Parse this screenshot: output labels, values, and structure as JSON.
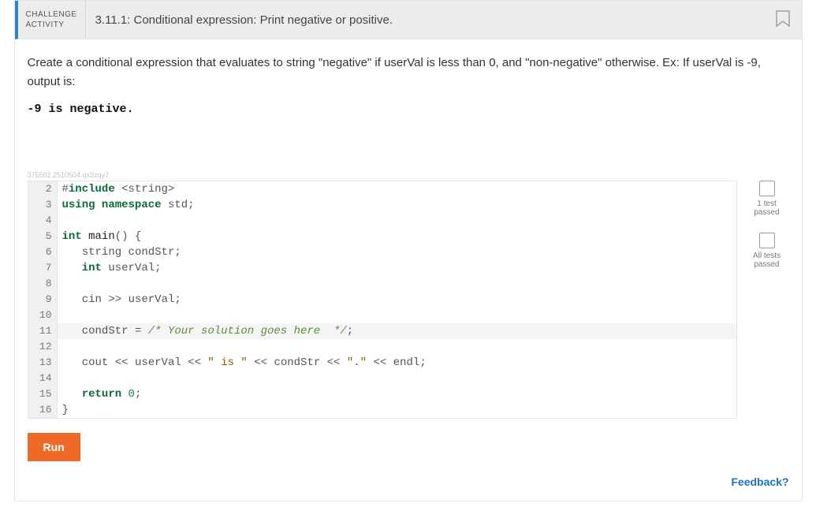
{
  "header": {
    "badge_line1": "CHALLENGE",
    "badge_line2": "ACTIVITY",
    "title": "3.11.1: Conditional expression: Print negative or positive."
  },
  "instructions": {
    "text": "Create a conditional expression that evaluates to string \"negative\" if userVal is less than 0, and \"non-negative\" otherwise. Ex: If userVal is -9, output is:",
    "example_output": "-9 is negative."
  },
  "watermark": "375502.2510504.qx3zqy7",
  "code": {
    "lines": [
      {
        "n": 2,
        "tokens": [
          [
            "pun",
            "#"
          ],
          [
            "kw",
            "include"
          ],
          [
            "pun",
            " "
          ],
          [
            "op",
            "<"
          ],
          [
            "ns",
            "string"
          ],
          [
            "op",
            ">"
          ]
        ]
      },
      {
        "n": 3,
        "tokens": [
          [
            "kw",
            "using"
          ],
          [
            "pun",
            " "
          ],
          [
            "kw",
            "namespace"
          ],
          [
            "pun",
            " "
          ],
          [
            "ns",
            "std"
          ],
          [
            "pun",
            ";"
          ]
        ]
      },
      {
        "n": 4,
        "tokens": []
      },
      {
        "n": 5,
        "tokens": [
          [
            "typ",
            "int"
          ],
          [
            "pun",
            " "
          ],
          [
            "fn",
            "main"
          ],
          [
            "pun",
            "()"
          ],
          [
            "pun",
            " "
          ],
          [
            "pun",
            "{"
          ]
        ]
      },
      {
        "n": 6,
        "tokens": [
          [
            "pun",
            "   "
          ],
          [
            "ns",
            "string"
          ],
          [
            "pun",
            " "
          ],
          [
            "ns",
            "condStr"
          ],
          [
            "pun",
            ";"
          ]
        ]
      },
      {
        "n": 7,
        "tokens": [
          [
            "pun",
            "   "
          ],
          [
            "typ",
            "int"
          ],
          [
            "pun",
            " "
          ],
          [
            "ns",
            "userVal"
          ],
          [
            "pun",
            ";"
          ]
        ]
      },
      {
        "n": 8,
        "tokens": []
      },
      {
        "n": 9,
        "tokens": [
          [
            "pun",
            "   "
          ],
          [
            "ns",
            "cin"
          ],
          [
            "pun",
            " "
          ],
          [
            "op",
            ">>"
          ],
          [
            "pun",
            " "
          ],
          [
            "ns",
            "userVal"
          ],
          [
            "pun",
            ";"
          ]
        ]
      },
      {
        "n": 10,
        "tokens": []
      },
      {
        "n": 11,
        "highlight": true,
        "tokens": [
          [
            "pun",
            "   "
          ],
          [
            "ns",
            "condStr"
          ],
          [
            "pun",
            " "
          ],
          [
            "op",
            "="
          ],
          [
            "pun",
            " "
          ],
          [
            "cmt",
            "/* Your solution goes here  */"
          ],
          [
            "pun",
            ";"
          ]
        ]
      },
      {
        "n": 12,
        "tokens": []
      },
      {
        "n": 13,
        "tokens": [
          [
            "pun",
            "   "
          ],
          [
            "ns",
            "cout"
          ],
          [
            "pun",
            " "
          ],
          [
            "op",
            "<<"
          ],
          [
            "pun",
            " "
          ],
          [
            "ns",
            "userVal"
          ],
          [
            "pun",
            " "
          ],
          [
            "op",
            "<<"
          ],
          [
            "pun",
            " "
          ],
          [
            "str",
            "\" is \""
          ],
          [
            "pun",
            " "
          ],
          [
            "op",
            "<<"
          ],
          [
            "pun",
            " "
          ],
          [
            "ns",
            "condStr"
          ],
          [
            "pun",
            " "
          ],
          [
            "op",
            "<<"
          ],
          [
            "pun",
            " "
          ],
          [
            "str",
            "\".\""
          ],
          [
            "pun",
            " "
          ],
          [
            "op",
            "<<"
          ],
          [
            "pun",
            " "
          ],
          [
            "ns",
            "endl"
          ],
          [
            "pun",
            ";"
          ]
        ]
      },
      {
        "n": 14,
        "tokens": []
      },
      {
        "n": 15,
        "tokens": [
          [
            "pun",
            "   "
          ],
          [
            "kw",
            "return"
          ],
          [
            "pun",
            " "
          ],
          [
            "num",
            "0"
          ],
          [
            "pun",
            ";"
          ]
        ]
      },
      {
        "n": 16,
        "tokens": [
          [
            "pun",
            "}"
          ]
        ]
      }
    ]
  },
  "tests": {
    "one": {
      "label_line1": "1 test",
      "label_line2": "passed"
    },
    "all": {
      "label_line1": "All tests",
      "label_line2": "passed"
    }
  },
  "buttons": {
    "run": "Run"
  },
  "feedback_link": "Feedback?"
}
